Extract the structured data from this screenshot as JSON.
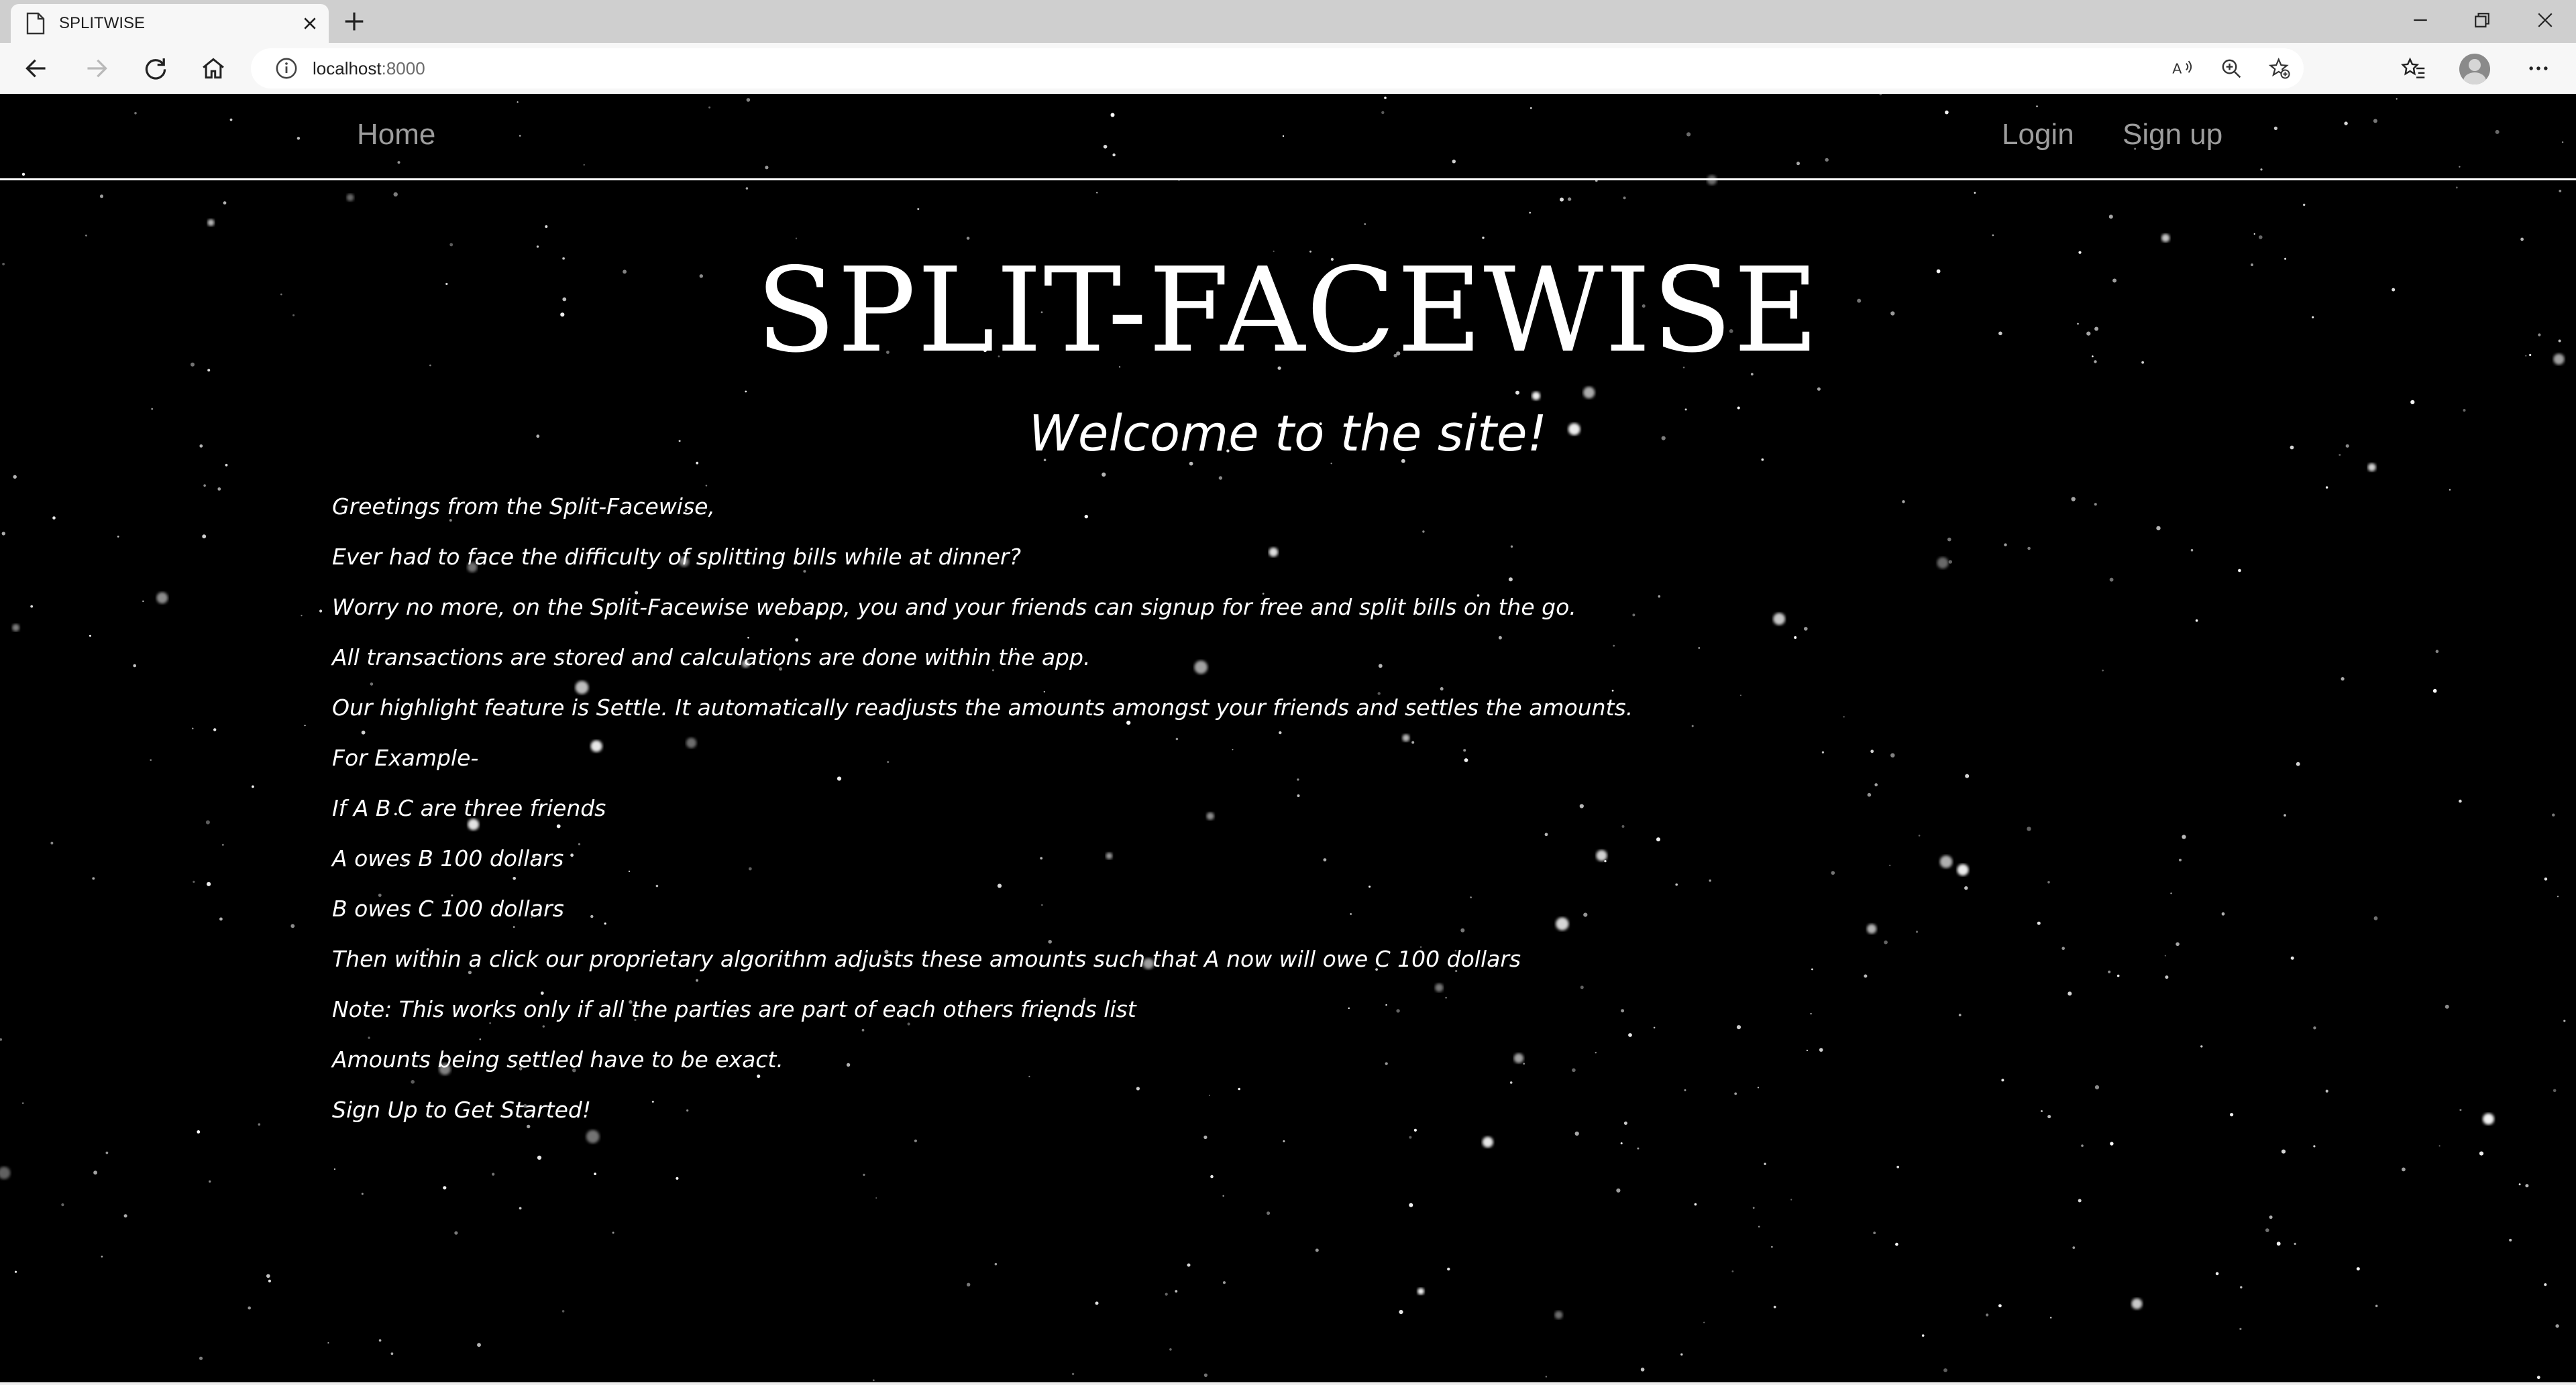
{
  "browser": {
    "tab_title": "SPLITWISE",
    "url_host": "localhost",
    "url_port": ":8000"
  },
  "nav": {
    "home": "Home",
    "login": "Login",
    "signup": "Sign up"
  },
  "hero": {
    "title": "SPLIT-FACEWISE",
    "subtitle": "Welcome to the site!"
  },
  "intro_lines": [
    "Greetings from the Split-Facewise,",
    "Ever had to face the difficulty of splitting bills while at dinner?",
    "Worry no more, on the Split-Facewise webapp, you and your friends can signup for free and split bills on the go.",
    "All transactions are stored and calculations are done within the app.",
    "Our highlight feature is Settle. It automatically readjusts the amounts amongst your friends and settles the amounts.",
    "For Example-",
    "If A B C are three friends",
    "A owes B 100 dollars",
    "B owes C 100 dollars",
    "Then within a click our proprietary algorithm adjusts these amounts such that A now will owe C 100 dollars",
    "Note: This works only if all the parties are part of each others friends list",
    "Amounts being settled have to be exact.",
    "Sign Up to Get Started!"
  ]
}
